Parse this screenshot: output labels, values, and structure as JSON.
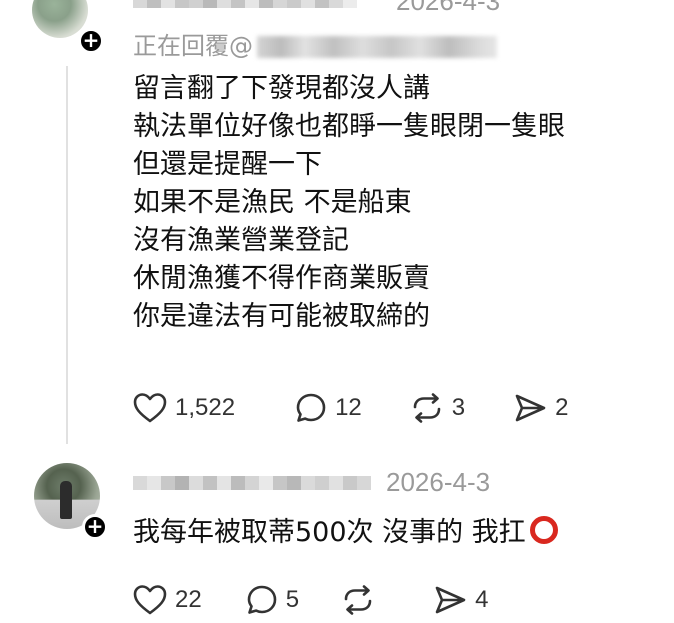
{
  "comment1": {
    "timestamp": "2026-4-3",
    "replying_prefix": "正在回覆@",
    "lines": [
      "留言翻了下發現都沒人講",
      "執法單位好像也都睜一隻眼閉一隻眼",
      "但還是提醒一下",
      "如果不是漁民 不是船東",
      "沒有漁業營業登記",
      "休閒漁獲不得作商業販賣",
      "你是違法有可能被取締的"
    ],
    "actions": {
      "likes": "1,522",
      "replies": "12",
      "reposts": "3",
      "shares": "2"
    }
  },
  "comment2": {
    "timestamp": "2026-4-3",
    "text": "我每年被取蒂500次 沒事的 我扛",
    "actions": {
      "likes": "22",
      "replies": "5",
      "reposts": "",
      "shares": "4"
    }
  },
  "icons": {
    "like": "heart-icon",
    "reply": "comment-bubble-icon",
    "repost": "repost-arrows-icon",
    "share": "send-paper-plane-icon",
    "follow": "plus-icon",
    "emoji": "hollow-red-circle-emoji"
  },
  "colors": {
    "timestamp": "#9a9a9a",
    "text": "#111111",
    "emoji_ring": "#d9281f"
  }
}
